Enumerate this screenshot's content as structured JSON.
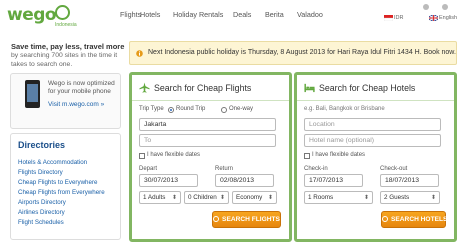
{
  "header": {
    "logo": "wego",
    "logo_sub": "Indonesia",
    "nav": [
      "Flights",
      "Hotels",
      "Holiday Rentals",
      "Deals",
      "Berita",
      "Valadoo"
    ],
    "locale": "IDR",
    "language": "English"
  },
  "left": {
    "tagline_title": "Save time, pay less, travel more",
    "tagline_body": "by searching 700 sites in the time it takes to search one.",
    "mobile_text": "Wego is now optimized for your mobile phone",
    "mobile_link": "Visit m.wego.com »",
    "directories_title": "Directories",
    "directories": [
      "Hotels & Accommodation",
      "Flights Directory",
      "Cheap Flights to Everywhere",
      "Cheap Flights from Everywhere",
      "Airports Directory",
      "Airlines Directory",
      "Flight Schedules"
    ]
  },
  "notice": {
    "text": "Next Indonesia public holiday is Thursday, 8 August 2013 for Hari Raya Idul Fitri 1434 H. Book now."
  },
  "flights": {
    "title": "Search for Cheap Flights",
    "trip_type_label": "Trip Type",
    "round_trip": "Round Trip",
    "one_way": "One-way",
    "from_value": "Jakarta",
    "to_placeholder": "To",
    "flexible": "I have flexible dates",
    "depart_label": "Depart",
    "depart_value": "30/07/2013",
    "return_label": "Return",
    "return_value": "02/08/2013",
    "adults": "1 Adults",
    "children": "0 Children",
    "cabin": "Economy",
    "button": "SEARCH FLIGHTS"
  },
  "hotels": {
    "title": "Search for Cheap Hotels",
    "hint": "e.g. Bali, Bangkok or Brisbane",
    "location_placeholder": "Location",
    "hotel_placeholder": "Hotel name (optional)",
    "flexible": "I have flexible dates",
    "checkin_label": "Check-in",
    "checkin_value": "17/07/2013",
    "checkout_label": "Check-out",
    "checkout_value": "18/07/2013",
    "rooms": "1 Rooms",
    "guests": "2 Guests",
    "button": "SEARCH HOTELS"
  },
  "colors": {
    "brand_green": "#62a83f",
    "panel_border": "#82b662",
    "button_orange": "#f29a1a",
    "link_blue": "#1a60a8",
    "notice_bg": "#fdf5d4"
  },
  "icons": [
    "plane-icon",
    "bed-icon",
    "calendar-icon",
    "info-icon",
    "search-icon",
    "phone-icon",
    "flag-icon",
    "user-icon"
  ]
}
